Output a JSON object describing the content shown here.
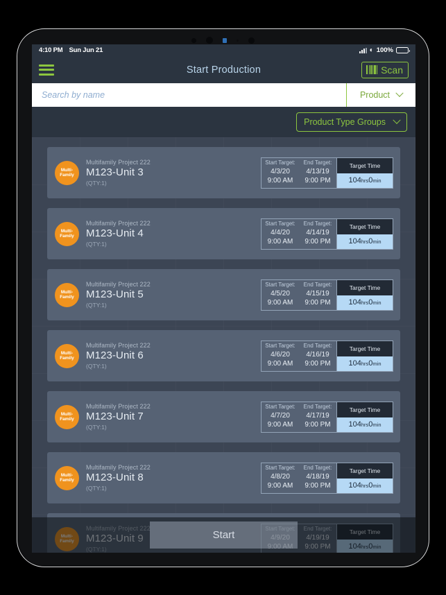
{
  "statusbar": {
    "time": "4:10 PM",
    "date": "Sun Jun 21",
    "battery_percent": "100%",
    "signal_icon": "cellular-signal-icon",
    "wifi_icon": "wifi-icon",
    "battery_icon": "battery-icon"
  },
  "navbar": {
    "menu_icon": "hamburger-menu-icon",
    "title": "Start Production",
    "scan_label": "Scan",
    "scan_icon": "barcode-icon"
  },
  "search": {
    "placeholder": "Search by name",
    "value": "",
    "filter_label": "Product",
    "filter_chevron_icon": "chevron-down-icon"
  },
  "filters": {
    "product_type_groups_label": "Product Type Groups",
    "chevron_icon": "chevron-down-icon"
  },
  "list": {
    "avatar_line1": "Multi-",
    "avatar_line2": "Family",
    "start_target_label": "Start Target:",
    "end_target_label": "End Target:",
    "target_time_label": "Target Time",
    "items": [
      {
        "project": "Multifamily Project 222",
        "unit": "M123-Unit 3",
        "qty": "(QTY:1)",
        "start_date": "4/3/20",
        "start_time": "9:00 AM",
        "end_date": "4/13/19",
        "end_time": "9:00 PM",
        "target_hours": "104",
        "target_hours_unit": "hrs",
        "target_minutes": "0",
        "target_minutes_unit": "min"
      },
      {
        "project": "Multifamily Project 222",
        "unit": "M123-Unit 4",
        "qty": "(QTY:1)",
        "start_date": "4/4/20",
        "start_time": "9:00 AM",
        "end_date": "4/14/19",
        "end_time": "9:00 PM",
        "target_hours": "104",
        "target_hours_unit": "hrs",
        "target_minutes": "0",
        "target_minutes_unit": "min"
      },
      {
        "project": "Multifamily Project 222",
        "unit": "M123-Unit 5",
        "qty": "(QTY:1)",
        "start_date": "4/5/20",
        "start_time": "9:00 AM",
        "end_date": "4/15/19",
        "end_time": "9:00 PM",
        "target_hours": "104",
        "target_hours_unit": "hrs",
        "target_minutes": "0",
        "target_minutes_unit": "min"
      },
      {
        "project": "Multifamily Project 222",
        "unit": "M123-Unit 6",
        "qty": "(QTY:1)",
        "start_date": "4/6/20",
        "start_time": "9:00 AM",
        "end_date": "4/16/19",
        "end_time": "9:00 PM",
        "target_hours": "104",
        "target_hours_unit": "hrs",
        "target_minutes": "0",
        "target_minutes_unit": "min"
      },
      {
        "project": "Multifamily Project 222",
        "unit": "M123-Unit 7",
        "qty": "(QTY:1)",
        "start_date": "4/7/20",
        "start_time": "9:00 AM",
        "end_date": "4/17/19",
        "end_time": "9:00 PM",
        "target_hours": "104",
        "target_hours_unit": "hrs",
        "target_minutes": "0",
        "target_minutes_unit": "min"
      },
      {
        "project": "Multifamily Project 222",
        "unit": "M123-Unit 8",
        "qty": "(QTY:1)",
        "start_date": "4/8/20",
        "start_time": "9:00 AM",
        "end_date": "4/18/19",
        "end_time": "9:00 PM",
        "target_hours": "104",
        "target_hours_unit": "hrs",
        "target_minutes": "0",
        "target_minutes_unit": "min"
      },
      {
        "project": "Multifamily Project 222",
        "unit": "M123-Unit 9",
        "qty": "(QTY:1)",
        "start_date": "4/9/20",
        "start_time": "9:00 AM",
        "end_date": "4/19/19",
        "end_time": "9:00 PM",
        "target_hours": "104",
        "target_hours_unit": "hrs",
        "target_minutes": "0",
        "target_minutes_unit": "min"
      }
    ]
  },
  "footer": {
    "start_label": "Start"
  },
  "colors": {
    "accent_green": "#8dc63f",
    "nav_background": "#2b3440",
    "screen_background": "#3c4554",
    "card_background": "#566274",
    "avatar_orange": "#f0931e",
    "target_time_value_background": "#b6d9f5",
    "title_blue": "#b9d4ea"
  }
}
